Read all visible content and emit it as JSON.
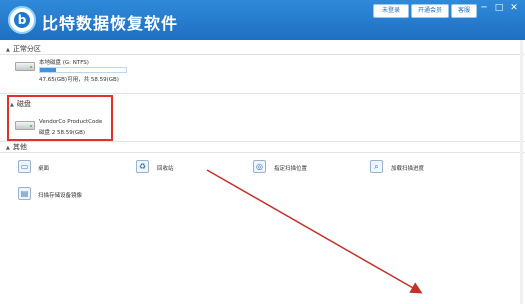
{
  "app": {
    "title": "比特数据恢复软件",
    "logo_letter": "b"
  },
  "titlebar": {
    "buttons": [
      {
        "label": "未登录"
      },
      {
        "label": "开通会员"
      },
      {
        "label": "客服"
      }
    ],
    "window_controls": [
      "─",
      "□",
      "✕"
    ]
  },
  "sections": {
    "partitions": {
      "title": "正常分区",
      "items": [
        {
          "name": "本地磁盘 (G: NTFS)",
          "info": "47.65(GB)可用，共 58.59(GB)",
          "used_fraction": 0.19
        }
      ]
    },
    "disks": {
      "title": "磁盘",
      "items": [
        {
          "name": "VendorCo ProductCode",
          "info": "磁盘 2    58.59(GB)"
        }
      ]
    },
    "other": {
      "title": "其他",
      "items": [
        {
          "label": "桌面",
          "icon": "desktop-icon"
        },
        {
          "label": "回收站",
          "icon": "recycle-bin-icon"
        },
        {
          "label": "指定扫描位置",
          "icon": "target-scan-icon"
        },
        {
          "label": "加载扫描进度",
          "icon": "load-progress-icon"
        },
        {
          "label": "扫描存储设备镜像",
          "icon": "disk-image-icon"
        }
      ]
    }
  },
  "annotations": {
    "highlight_color": "#e0322c",
    "arrow_color": "#c0342c"
  }
}
